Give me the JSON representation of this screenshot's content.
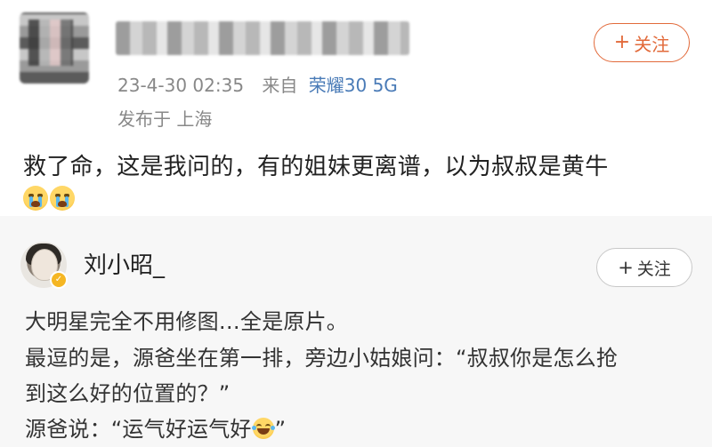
{
  "post": {
    "timestamp": "23-4-30 02:35",
    "from_label": "来自",
    "device": "荣耀30 5G",
    "location": "发布于 上海",
    "follow_label": "关注",
    "text": "救了命，这是我问的，有的姐妹更离谱，以为叔叔是黄牛",
    "emojis": [
      "crying-emoji",
      "crying-emoji"
    ]
  },
  "quote": {
    "author": "刘小昭_",
    "follow_label": "关注",
    "line1": "大明星完全不用修图…全是原片。",
    "line2": "最逗的是，源爸坐在第一排，旁边小姑娘问：“叔叔你是怎么抢",
    "line3": "到这么好的位置的？”",
    "line4_prefix": "源爸说：“运气好运气好",
    "line4_suffix": "”"
  },
  "colors": {
    "follow_accent": "#e26a3a",
    "device_link": "#4a7bb7",
    "quote_bg": "#f7f7f7",
    "verified_badge": "#f5b623"
  }
}
